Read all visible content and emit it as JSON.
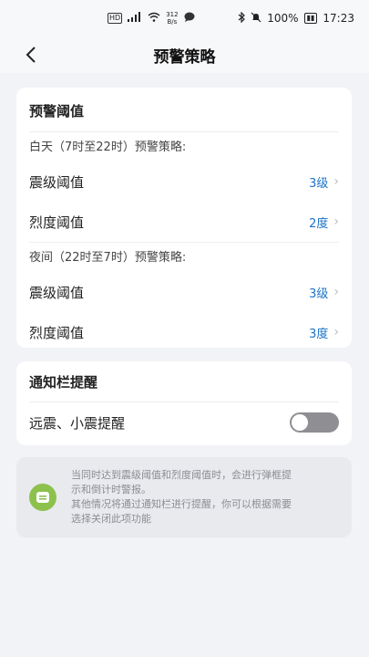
{
  "status_bar": {
    "net_speed_value": "312",
    "net_speed_unit": "B/s",
    "battery": "100%",
    "time": "17:23"
  },
  "nav": {
    "title": "预警策略"
  },
  "threshold_card": {
    "title": "预警阈值",
    "day_label": "白天（7时至22时）预警策略:",
    "day_rows": [
      {
        "label": "震级阈值",
        "value": "3级"
      },
      {
        "label": "烈度阈值",
        "value": "2度"
      }
    ],
    "night_label": "夜间（22时至7时）预警策略:",
    "night_rows": [
      {
        "label": "震级阈值",
        "value": "3级"
      },
      {
        "label": "烈度阈值",
        "value": "3度"
      }
    ]
  },
  "notify_card": {
    "title": "通知栏提醒",
    "toggle_label": "远震、小震提醒",
    "toggle_on": false
  },
  "info": {
    "line1": "当同时达到震级阈值和烈度阈值时，会进行弹框提",
    "line2": "示和倒计时警报。",
    "line3": "其他情况将通过通知栏进行提醒，你可以根据需要",
    "line4": "选择关闭此项功能"
  },
  "colors": {
    "accent": "#1a73c9",
    "toggle_off": "#8e8e93",
    "info_icon": "#8dc14d"
  }
}
